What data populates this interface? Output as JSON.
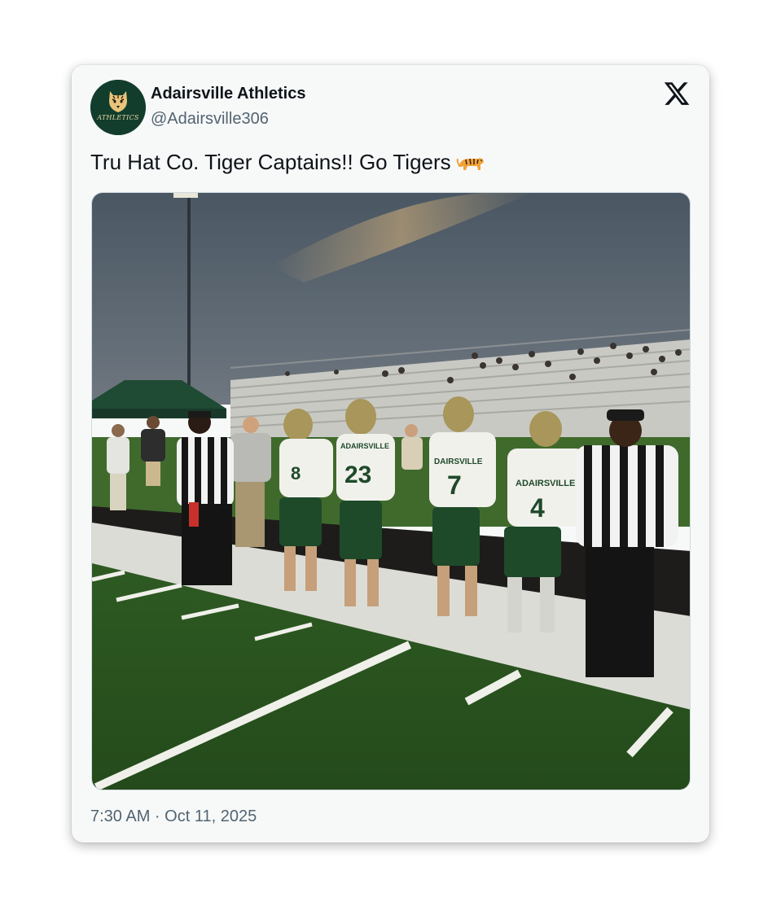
{
  "tweet": {
    "author_name": "Adairsville Athletics",
    "author_handle": "@Adairsville306",
    "avatar_text": "ATHLETICS",
    "text": "Tru Hat Co. Tiger Captains!! Go Tigers",
    "emoji": "tiger-emoji",
    "timestamp": "7:30 AM · Oct 11, 2025"
  },
  "photo": {
    "description_icon": "photo-football-captains",
    "jersey_numbers": [
      "8",
      "23",
      "7",
      "4"
    ],
    "jersey_team": "ADAIRSVILLE"
  },
  "brand": {
    "logo": "x-logo-icon"
  },
  "colors": {
    "card_bg": "#f7f9f9",
    "text_primary": "#0f1419",
    "text_secondary": "#536471",
    "team_green": "#123d2c",
    "gold": "#c8b07a"
  }
}
